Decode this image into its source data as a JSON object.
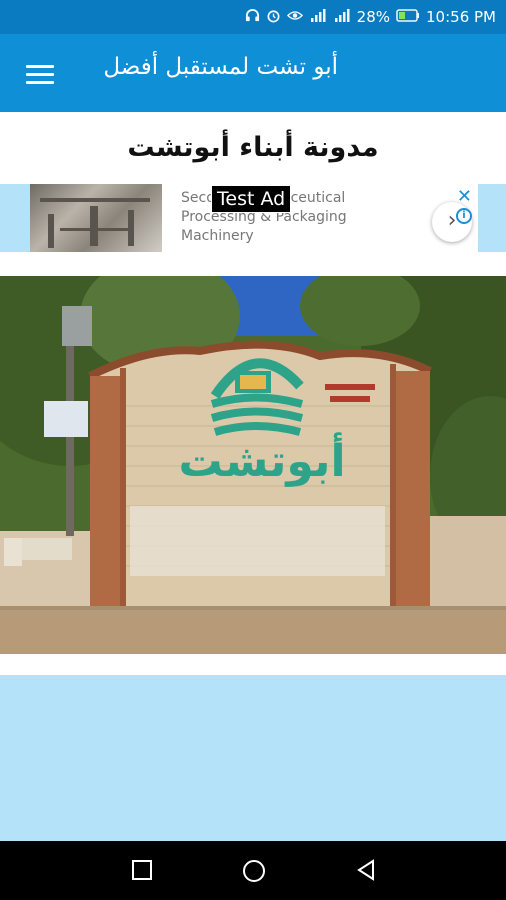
{
  "status_bar": {
    "battery": "28%",
    "time": "10:56 PM",
    "icons": [
      "headset-icon",
      "alarm-icon",
      "eye-icon",
      "signal-icon",
      "signal-icon",
      "battery-icon"
    ]
  },
  "app_bar": {
    "title": "أبو تشت لمستقبل أفضل",
    "menu_icon": "menu-icon"
  },
  "blog_title": "مدونة أبناء أبوتشت",
  "ad": {
    "label": "Test Ad",
    "text": "Second Pharmaceutical Processing & Packaging Machinery",
    "close_icon": "close-icon",
    "info_icon": "info-icon",
    "next_icon": "chevron-right-icon"
  },
  "photo": {
    "sign_text": "أبوتشت"
  },
  "nav": {
    "icons": [
      "recents-square-icon",
      "home-circle-icon",
      "back-triangle-icon"
    ]
  },
  "colors": {
    "status_bar": "#0a7bc0",
    "app_bar": "#0f8fd6",
    "light_blue": "#b4e2f9",
    "nav_bar": "#000000"
  }
}
